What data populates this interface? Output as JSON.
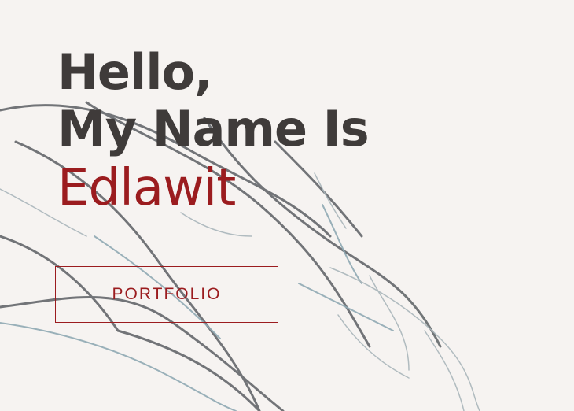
{
  "hero": {
    "line1": "Hello,",
    "line2": "My Name Is",
    "name": "Edlawit"
  },
  "cta": {
    "label": "PORTFOLIO"
  },
  "colors": {
    "background": "#f6f3f1",
    "heading": "#3f3b3a",
    "accent": "#9b1c1f"
  }
}
